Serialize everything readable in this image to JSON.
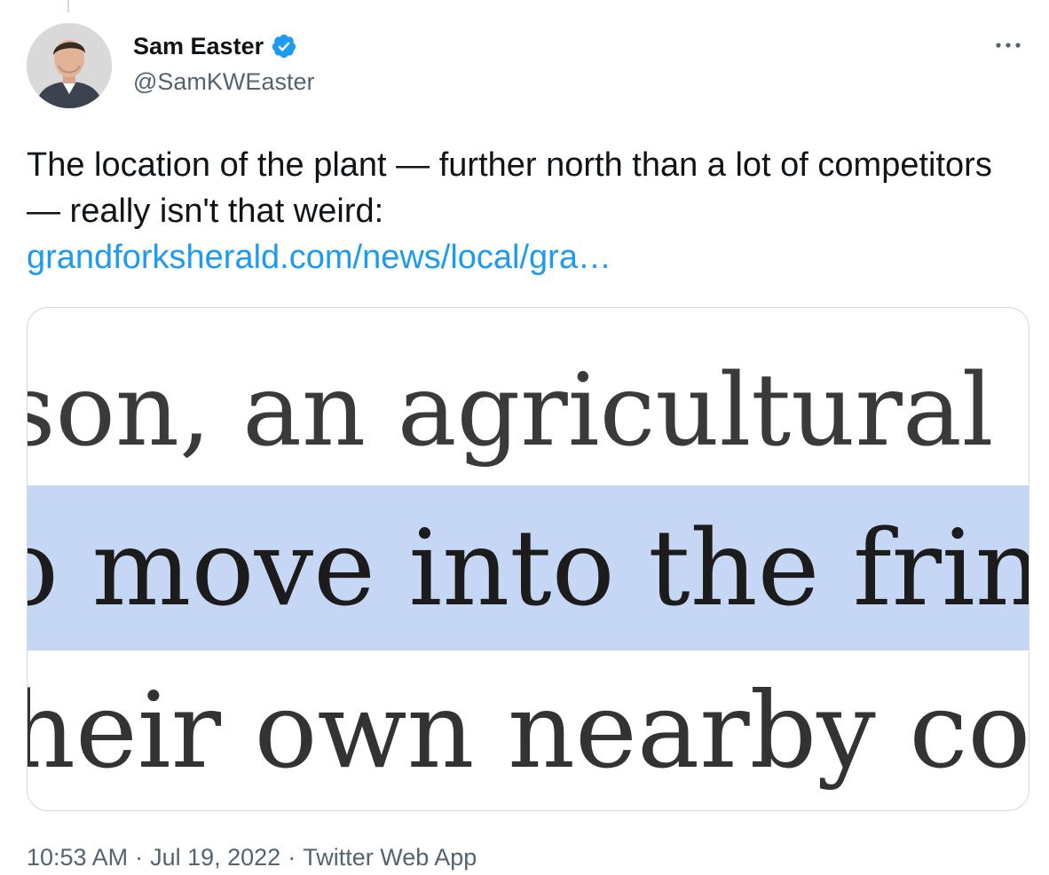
{
  "author": {
    "display_name": "Sam Easter",
    "handle": "@SamKWEaster",
    "verified": true
  },
  "tweet": {
    "text": "The location of the plant — further north than a lot of competitors — really isn't that weird:",
    "link_text": "grandforksherald.com/news/local/gra…"
  },
  "media": {
    "line_1": "son, an agricultural e",
    "line_2": "o move into the fring",
    "line_3": "heir own nearby corr"
  },
  "meta": {
    "time": "10:53 AM",
    "date": "Jul 19, 2022",
    "source": "Twitter Web App",
    "separator": "·"
  },
  "icons": {
    "verified": "verified-badge-icon",
    "more": "more-options-icon"
  },
  "colors": {
    "link": "#1d9bf0",
    "secondary_text": "#536471",
    "highlight": "#c6d7f5"
  }
}
